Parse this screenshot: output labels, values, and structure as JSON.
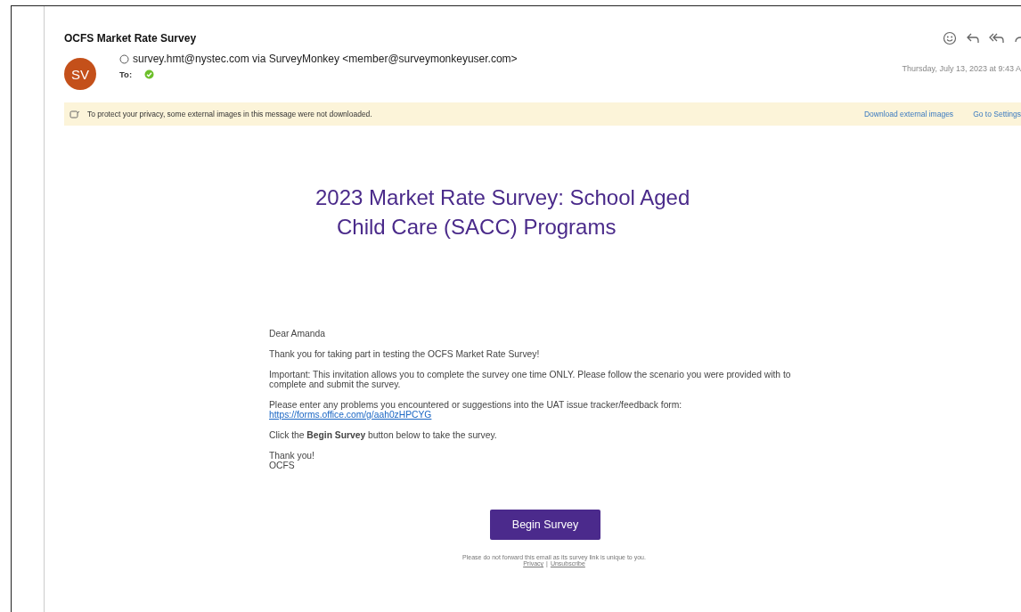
{
  "subject": "OCFS Market Rate Survey",
  "sender": {
    "initials": "SV",
    "from": "survey.hmt@nystec.com via SurveyMonkey <member@surveymonkeyuser.com>",
    "to_label": "To:",
    "date": "Thursday, July 13, 2023 at 9:43 A"
  },
  "privacy_banner": {
    "message": "To protect your privacy, some external images in this message were not downloaded.",
    "actions": [
      "Download external images",
      "Go to Settings"
    ]
  },
  "email": {
    "title_lines": [
      "2023 Market Rate Survey: School Aged",
      "Child Care (SACC) Programs"
    ],
    "greeting": "Dear Amanda",
    "paragraphs": [
      "Thank you for taking part in testing the OCFS Market Rate Survey!",
      "Important: This invitation allows you to complete the survey one time ONLY.  Please follow the scenario you were provided with to complete and submit the survey."
    ],
    "feedback_text": "Please enter any problems you encountered or suggestions into the UAT issue tracker/feedback form:",
    "feedback_link": "https://forms.office.com/g/aah0zHPCYG",
    "instruction": "Click the **Begin Survey** button below to take the survey.",
    "closing": [
      "Thank you!",
      "OCFS"
    ],
    "button": "Begin Survey",
    "footer_note": "Please do not forward this email as its survey link is unique to you.",
    "footer_links": [
      "Privacy",
      "Unsubscribe"
    ],
    "footer_separator": "|"
  }
}
